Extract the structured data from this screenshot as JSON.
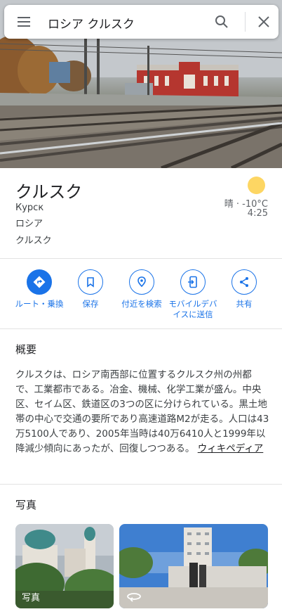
{
  "search": {
    "query": "ロシア クルスク"
  },
  "place": {
    "name": "クルスク",
    "native_name": "Курск",
    "country": "ロシア",
    "region": "クルスク"
  },
  "weather": {
    "summary": "晴 · -10°C",
    "time": "4:25",
    "icon": "sun-icon"
  },
  "actions": [
    {
      "label": "ルート・乗換",
      "icon": "directions-icon"
    },
    {
      "label": "保存",
      "icon": "bookmark-icon"
    },
    {
      "label": "付近を検索",
      "icon": "nearby-icon"
    },
    {
      "label_line1": "モバイルデバ",
      "label_line2": "イスに送信",
      "icon": "send-to-phone-icon"
    },
    {
      "label": "共有",
      "icon": "share-icon"
    }
  ],
  "overview": {
    "heading": "概要",
    "text": "クルスクは、ロシア南西部に位置するクルスク州の州都で、工業都市である。冶金、機械、化学工業が盛ん。中央区、セイム区、鉄道区の3つの区に分けられている。黒土地帯の中心で交通の要所であり高速道路M2が走る。人口は43万5100人であり、2005年当時は40万6410人と1999年以降減少傾向にあったが、回復しつつある。",
    "link": "ウィキペディア"
  },
  "photos": {
    "heading": "写真",
    "items": [
      {
        "caption": "写真"
      },
      {
        "caption": "",
        "icon": "360-view-icon"
      }
    ]
  },
  "colors": {
    "accent": "#1a73e8",
    "sun": "#fdd663"
  }
}
